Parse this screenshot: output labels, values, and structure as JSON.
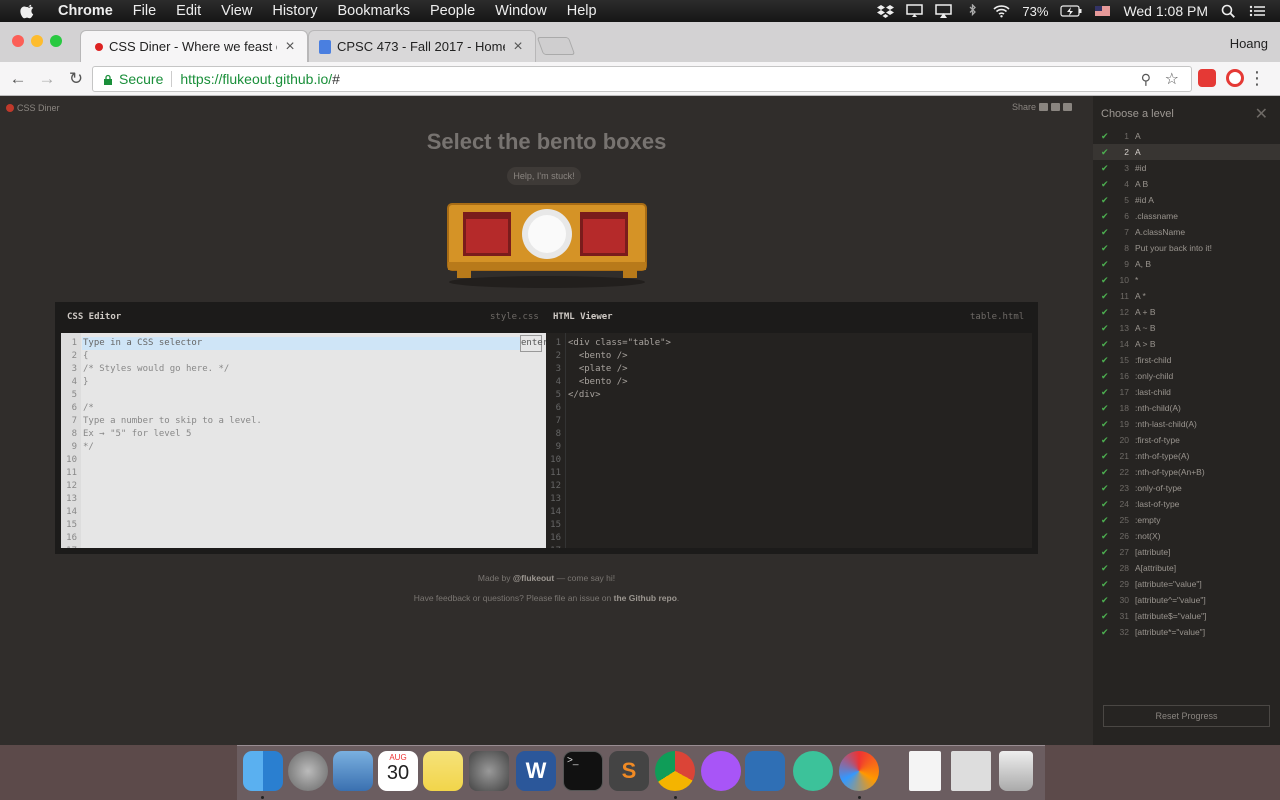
{
  "menubar": {
    "app": "Chrome",
    "items": [
      "File",
      "Edit",
      "View",
      "History",
      "Bookmarks",
      "People",
      "Window",
      "Help"
    ],
    "battery": "73%",
    "clock": "Wed 1:08 PM"
  },
  "browser": {
    "tabs": [
      {
        "title": "CSS Diner - Where we feast on CSS selectors!",
        "active": true
      },
      {
        "title": "CPSC 473 - Fall 2017 - Homework",
        "active": false
      }
    ],
    "profile": "Hoang",
    "secure_label": "Secure",
    "url": "https://flukeout.github.io/",
    "url_hash": "#"
  },
  "game": {
    "logo": "CSS Diner",
    "share": "Share",
    "title": "Select the bento boxes",
    "help_button": "Help, I'm stuck!",
    "css_editor_label": "CSS Editor",
    "css_file": "style.css",
    "html_viewer_label": "HTML Viewer",
    "html_file": "table.html",
    "css_placeholder": "Type in a CSS selector",
    "css_lines": "{\n/* Styles would go here. */\n}\n\n/*\nType a number to skip to a level.\nEx → \"5\" for level 5\n*/",
    "css_line_numbers": "1\n2\n3\n4\n5\n6\n7\n8\n9\n10\n11\n12\n13\n14\n15\n16\n17",
    "enter_button": "enter",
    "html_code": "<div class=\"table\">\n  <bento />\n  <plate />\n  <bento />\n</div>",
    "html_line_numbers": "1\n2\n3\n4\n5\n6\n7\n8\n9\n10\n11\n12\n13\n14\n15\n16\n17",
    "credit_prefix": "Made by",
    "credit_author": "@flukeout",
    "credit_suffix": "— come say hi!",
    "feedback_prefix": "Have feedback or questions? Please file an issue on",
    "feedback_link": "the Github repo",
    "feedback_suffix": "."
  },
  "sidebar": {
    "title": "Choose a level",
    "current_level": 2,
    "levels": [
      {
        "n": "1",
        "name": "A"
      },
      {
        "n": "2",
        "name": "A"
      },
      {
        "n": "3",
        "name": "#id"
      },
      {
        "n": "4",
        "name": "A B"
      },
      {
        "n": "5",
        "name": "#id A"
      },
      {
        "n": "6",
        "name": ".classname"
      },
      {
        "n": "7",
        "name": "A.className"
      },
      {
        "n": "8",
        "name": "Put your back into it!"
      },
      {
        "n": "9",
        "name": "A, B"
      },
      {
        "n": "10",
        "name": "*"
      },
      {
        "n": "11",
        "name": "A *"
      },
      {
        "n": "12",
        "name": "A + B"
      },
      {
        "n": "13",
        "name": "A ~ B"
      },
      {
        "n": "14",
        "name": "A > B"
      },
      {
        "n": "15",
        "name": ":first-child"
      },
      {
        "n": "16",
        "name": ":only-child"
      },
      {
        "n": "17",
        "name": ":last-child"
      },
      {
        "n": "18",
        "name": ":nth-child(A)"
      },
      {
        "n": "19",
        "name": ":nth-last-child(A)"
      },
      {
        "n": "20",
        "name": ":first-of-type"
      },
      {
        "n": "21",
        "name": ":nth-of-type(A)"
      },
      {
        "n": "22",
        "name": ":nth-of-type(An+B)"
      },
      {
        "n": "23",
        "name": ":only-of-type"
      },
      {
        "n": "24",
        "name": ":last-of-type"
      },
      {
        "n": "25",
        "name": ":empty"
      },
      {
        "n": "26",
        "name": ":not(X)"
      },
      {
        "n": "27",
        "name": "[attribute]"
      },
      {
        "n": "28",
        "name": "A[attribute]"
      },
      {
        "n": "29",
        "name": "[attribute=\"value\"]"
      },
      {
        "n": "30",
        "name": "[attribute^=\"value\"]"
      },
      {
        "n": "31",
        "name": "[attribute$=\"value\"]"
      },
      {
        "n": "32",
        "name": "[attribute*=\"value\"]"
      }
    ],
    "check": "✔",
    "reset_button": "Reset Progress"
  },
  "dock": {
    "calendar_month": "AUG",
    "calendar_day": "30",
    "apps": [
      "finder-icon",
      "launchpad-icon",
      "mail-icon",
      "calendar-icon",
      "notes-icon",
      "system-preferences-icon",
      "word-icon",
      "terminal-icon",
      "sublime-text-icon",
      "chrome-icon",
      "podcasts-icon",
      "virtualbox-icon",
      "atom-icon",
      "macos-installer-icon",
      "document-icon",
      "screenshot-icon",
      "trash-icon"
    ]
  }
}
